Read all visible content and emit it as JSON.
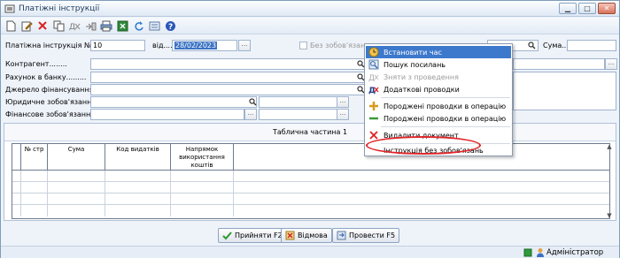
{
  "window": {
    "title": "Платіжні інструкції"
  },
  "form": {
    "instr_label": "Платіжна інструкція №.......",
    "instr_number": "10",
    "from_label": "від.....",
    "date": "28/02/2023",
    "no_obligation_label": "Без зобов'язань",
    "sum_label": "Сума....",
    "sum_value": "",
    "counterparty_label": "Контрагент........",
    "bank_account_label": "Рахунок в банку.........",
    "funding_label": "Джерело фінансування.....",
    "legal_obligation_label": "Юридичне зобов'язання....",
    "financial_obligation_label": "Фінансове зобов'язання.....",
    "dots": "..."
  },
  "table": {
    "title": "Таблична частина 1",
    "columns": [
      "№ стр",
      "Сума",
      "Код видатків",
      "Напрямок використання коштів"
    ]
  },
  "buttons": {
    "accept": "Прийняти F2",
    "reject": "Відмова",
    "post": "Провести F5"
  },
  "context_menu": {
    "items": [
      {
        "label": "Встановити час",
        "icon": "clock-icon",
        "state": "highlighted"
      },
      {
        "label": "Пошук посилань",
        "icon": "search-links-icon",
        "state": "normal"
      },
      {
        "label": "Зняти з проведення",
        "icon": "unpost-icon",
        "state": "disabled"
      },
      {
        "label": "Додаткові проводки",
        "icon": "extra-entries-icon",
        "state": "normal"
      },
      {
        "label": "Породжені проводки в операцію",
        "icon": "plus-icon",
        "state": "normal"
      },
      {
        "label": "Породжені проводки в операцію",
        "icon": "minus-icon",
        "state": "normal"
      },
      {
        "label": "Видалити документ",
        "icon": "delete-icon",
        "state": "normal"
      },
      {
        "label": "Інструкція без зобов'язань",
        "icon": "",
        "state": "circled"
      }
    ]
  },
  "status": {
    "user": "Адміністратор"
  },
  "colors": {
    "accent": "#3c78cc",
    "annotation": "#e0262a",
    "selected_date_bg": "#3b73c4"
  }
}
